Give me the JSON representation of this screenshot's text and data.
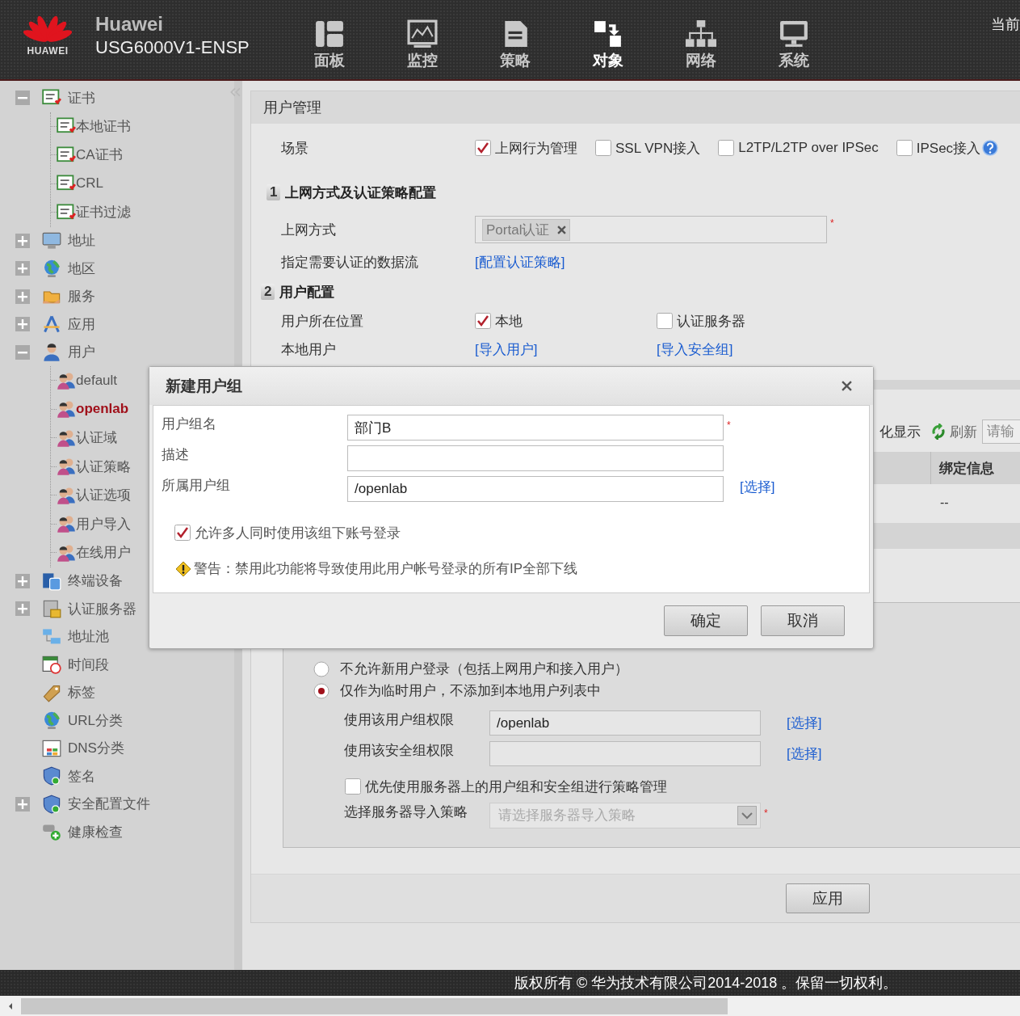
{
  "header": {
    "logo_text": "HUAWEI",
    "brand": "Huawei",
    "model": "USG6000V1-ENSP",
    "right_text": "当前",
    "nav": [
      {
        "label": "面板",
        "selected": false
      },
      {
        "label": "监控",
        "selected": false
      },
      {
        "label": "策略",
        "selected": false
      },
      {
        "label": "对象",
        "selected": true
      },
      {
        "label": "网络",
        "selected": false
      },
      {
        "label": "系统",
        "selected": false
      }
    ]
  },
  "sidebar": {
    "items": [
      {
        "label": "证书",
        "kind": "branch",
        "expanded": true,
        "selected": false,
        "children": [
          {
            "label": "本地证书",
            "selected": false
          },
          {
            "label": "CA证书",
            "selected": false
          },
          {
            "label": "CRL",
            "selected": false
          },
          {
            "label": "证书过滤",
            "selected": false
          }
        ]
      },
      {
        "label": "地址",
        "kind": "branch",
        "expanded": false,
        "selected": false
      },
      {
        "label": "地区",
        "kind": "branch",
        "expanded": false,
        "selected": false
      },
      {
        "label": "服务",
        "kind": "branch",
        "expanded": false,
        "selected": false
      },
      {
        "label": "应用",
        "kind": "branch",
        "expanded": false,
        "selected": false
      },
      {
        "label": "用户",
        "kind": "branch",
        "expanded": true,
        "selected": false,
        "children": [
          {
            "label": "default",
            "selected": false
          },
          {
            "label": "openlab",
            "selected": true
          },
          {
            "label": "认证域",
            "selected": false
          },
          {
            "label": "认证策略",
            "selected": false
          },
          {
            "label": "认证选项",
            "selected": false
          },
          {
            "label": "用户导入",
            "selected": false
          },
          {
            "label": "在线用户",
            "selected": false
          }
        ]
      },
      {
        "label": "终端设备",
        "kind": "branch",
        "expanded": false,
        "selected": false
      },
      {
        "label": "认证服务器",
        "kind": "branch",
        "expanded": false,
        "selected": false
      },
      {
        "label": "地址池",
        "kind": "leaf",
        "selected": false
      },
      {
        "label": "时间段",
        "kind": "leaf",
        "selected": false
      },
      {
        "label": "标签",
        "kind": "leaf",
        "selected": false
      },
      {
        "label": "URL分类",
        "kind": "leaf",
        "selected": false
      },
      {
        "label": "DNS分类",
        "kind": "leaf",
        "selected": false
      },
      {
        "label": "签名",
        "kind": "leaf",
        "selected": false
      },
      {
        "label": "安全配置文件",
        "kind": "branch",
        "expanded": false,
        "selected": false
      },
      {
        "label": "健康检查",
        "kind": "leaf",
        "selected": false
      }
    ]
  },
  "panel": {
    "title": "用户管理",
    "scene": {
      "label": "场景",
      "options": [
        {
          "label": "上网行为管理",
          "checked": true
        },
        {
          "label": "SSL VPN接入",
          "checked": false
        },
        {
          "label": "L2TP/L2TP over IPSec",
          "checked": false
        },
        {
          "label": "IPSec接入",
          "checked": false
        }
      ]
    },
    "section_1": {
      "number": "1",
      "title": "上网方式及认证策略配置"
    },
    "access_mode": {
      "label": "上网方式",
      "tags": [
        "Portal认证"
      ],
      "required_mark": "*"
    },
    "auth_flow": {
      "label": "指定需要认证的数据流",
      "link": "[配置认证策略]"
    },
    "section_2": {
      "number": "2",
      "title": "用户配置"
    },
    "user_location": {
      "label": "用户所在位置",
      "options": [
        {
          "label": "本地",
          "checked": true
        },
        {
          "label": "认证服务器",
          "checked": false
        }
      ]
    },
    "local_user": {
      "label": "本地用户",
      "links": [
        "[导入用户]",
        "[导入安全组]"
      ]
    },
    "list_toolbar": {
      "text": "化显示",
      "refresh": "刷新",
      "search_placeholder": "请输"
    },
    "table": {
      "columns": [
        "绑定信息"
      ],
      "rows": [
        [
          "--"
        ]
      ]
    },
    "new_user": {
      "options": [
        {
          "label": "不允许新用户登录（包括上网用户和接入用户）",
          "selected": false
        },
        {
          "label": "仅作为临时用户，不添加到本地用户列表中",
          "selected": true
        }
      ],
      "group_permission": {
        "label": "使用该用户组权限",
        "value": "/openlab",
        "link": "[选择]"
      },
      "security_permission": {
        "label": "使用该安全组权限",
        "link": "[选择]"
      },
      "prefer_server": {
        "label": "优先使用服务器上的用户组和安全组进行策略管理",
        "checked": false
      },
      "import_policy": {
        "label": "选择服务器导入策略",
        "placeholder": "请选择服务器导入策略",
        "required_mark": "*"
      }
    },
    "apply_button": "应用"
  },
  "dialog": {
    "title": "新建用户组",
    "fields": [
      {
        "label": "用户组名",
        "value": "部门B",
        "required_mark": "*"
      },
      {
        "label": "描述"
      },
      {
        "label": "所属用户组",
        "value": "/openlab",
        "link": "[选择]"
      }
    ],
    "allow_multi": {
      "label": "允许多人同时使用该组下账号登录",
      "checked": true
    },
    "warning": "警告：禁用此功能将导致使用此用户帐号登录的所有IP全部下线",
    "buttons": [
      "确定",
      "取消"
    ]
  },
  "footer": {
    "copyright": "版权所有 © 华为技术有限公司2014-2018 。保留一切权利。"
  }
}
